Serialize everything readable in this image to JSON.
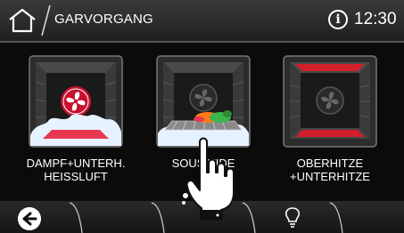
{
  "header": {
    "title": "GARVORGANG",
    "time": "12:30",
    "info_glyph": "i",
    "home_icon": "home-icon"
  },
  "programs": [
    {
      "label_line1": "DAMPF+UNTERH.",
      "label_line2": "HEISSLUFT",
      "icon": "fan-icon",
      "accent": "#e8384f"
    },
    {
      "label_line1": "SOUS VIDE",
      "label_line2": "",
      "icon": "fan-icon",
      "accent": "#3cb44b"
    },
    {
      "label_line1": "OBERHITZE",
      "label_line2": "+UNTERHITZE",
      "icon": "fan-icon",
      "accent": "#c8102e"
    }
  ],
  "bottom": {
    "back_icon": "back-arrow-icon",
    "light_icon": "lightbulb-icon"
  },
  "colors": {
    "header_bg": "#2b2b2b",
    "background": "#0b0b0b",
    "heat_red": "#d21f2c",
    "steam": "#e6f2ff"
  }
}
